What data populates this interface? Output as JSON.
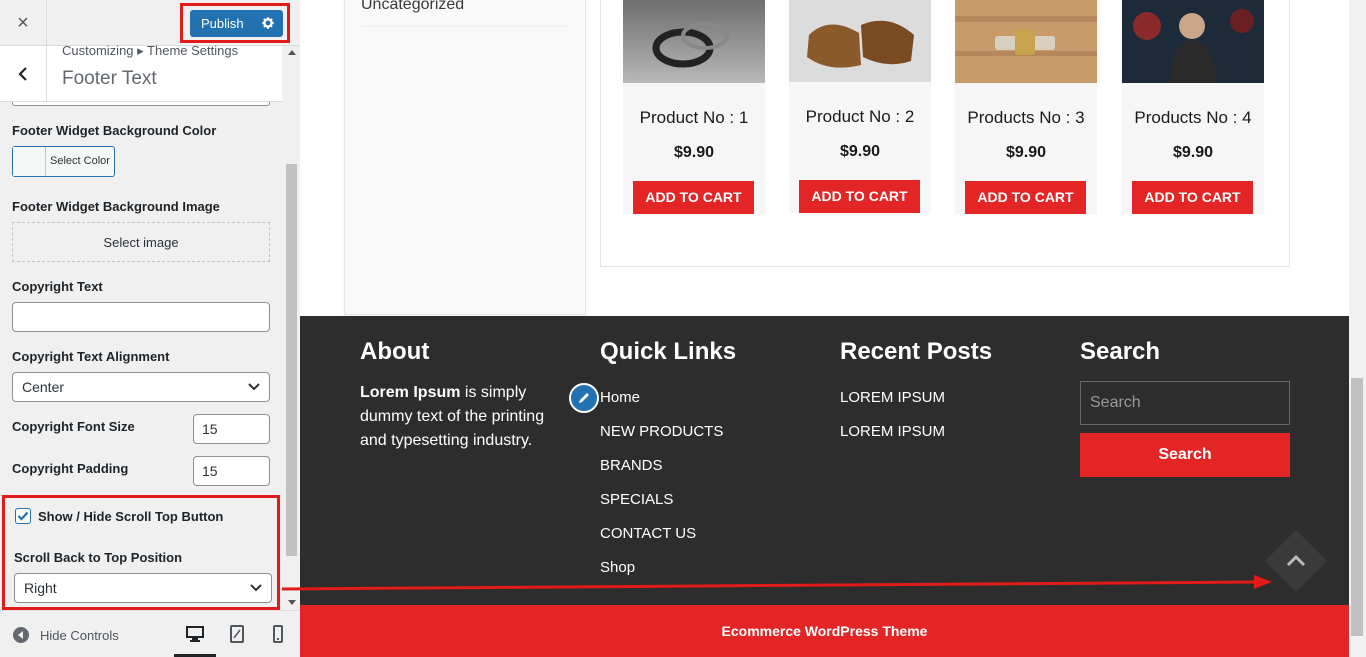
{
  "customizer": {
    "close_label": "×",
    "publish_label": "Publish",
    "breadcrumb": "Customizing ▸ Theme Settings",
    "section_title": "Footer Text",
    "controls": {
      "widget_bg_color_label": "Footer Widget Background Color",
      "select_color_label": "Select Color",
      "widget_bg_image_label": "Footer Widget Background Image",
      "select_image_label": "Select image",
      "copyright_text_label": "Copyright Text",
      "copyright_text_value": "",
      "copyright_alignment_label": "Copyright Text Alignment",
      "copyright_alignment_value": "Center",
      "copyright_font_size_label": "Copyright Font Size",
      "copyright_font_size_value": "15",
      "copyright_padding_label": "Copyright Padding",
      "copyright_padding_value": "15",
      "scroll_top_toggle_label": "Show / Hide Scroll Top Button",
      "scroll_top_toggle_checked": true,
      "scroll_position_label": "Scroll Back to Top Position",
      "scroll_position_value": "Right"
    },
    "footer": {
      "hide_controls_label": "Hide Controls"
    }
  },
  "preview": {
    "category_link": "Uncategorized",
    "products": [
      {
        "name": "Product No : 1",
        "price": "$9.90",
        "cart_label": "ADD TO CART"
      },
      {
        "name": "Product No : 2",
        "price": "$9.90",
        "cart_label": "ADD TO CART"
      },
      {
        "name": "Products No : 3",
        "price": "$9.90",
        "cart_label": "ADD TO CART"
      },
      {
        "name": "Products No : 4",
        "price": "$9.90",
        "cart_label": "ADD TO CART"
      }
    ],
    "footer": {
      "about_heading": "About",
      "about_bold": "Lorem Ipsum",
      "about_text": " is simply dummy text of the printing and typesetting industry.",
      "quick_links_heading": "Quick Links",
      "quick_links": [
        "Home",
        "NEW PRODUCTS",
        "BRANDS",
        "SPECIALS",
        "CONTACT US",
        "Shop"
      ],
      "recent_posts_heading": "Recent Posts",
      "recent_posts": [
        "LOREM IPSUM",
        "LOREM IPSUM"
      ],
      "search_heading": "Search",
      "search_placeholder": "Search",
      "search_button": "Search"
    },
    "copyright": "Ecommerce WordPress Theme"
  },
  "colors": {
    "publish_blue": "#2271b1",
    "highlight_red": "#e11a1a",
    "footer_dark": "#2d2d2d",
    "accent_red": "#e32526"
  }
}
